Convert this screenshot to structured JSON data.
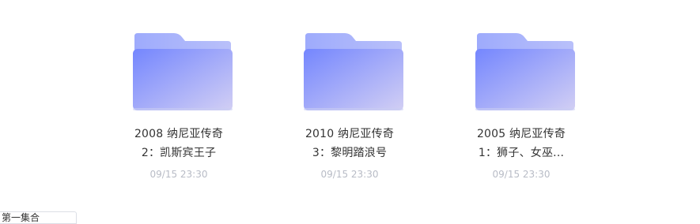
{
  "folders": [
    {
      "name_line1": "2008 纳尼亚传奇",
      "name_line2": "2：凯斯宾王子",
      "date": "09/15 23:30"
    },
    {
      "name_line1": "2010 纳尼亚传奇",
      "name_line2": "3：黎明踏浪号",
      "date": "09/15 23:30"
    },
    {
      "name_line1": "2005 纳尼亚传奇",
      "name_line2": "1：狮子、女巫...",
      "date": "09/15 23:30"
    }
  ],
  "bottom_tab": {
    "label": "第一集合"
  },
  "colors": {
    "folder_back": "#a7b2fb",
    "folder_front_start": "#7b8dfd",
    "folder_front_end": "#cac8f5",
    "date_text": "#b8bcc6",
    "name_text": "#333333"
  },
  "icons": {
    "folder": "folder-icon"
  }
}
